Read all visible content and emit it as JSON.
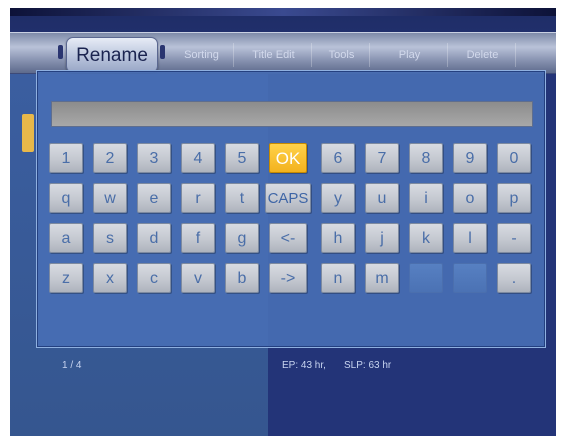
{
  "tabs": {
    "active": "Rename",
    "items": [
      "Sorting",
      "Title Edit",
      "Tools",
      "Play",
      "Delete"
    ]
  },
  "input": {
    "value": ""
  },
  "keyboard": {
    "rows": [
      [
        "1",
        "2",
        "3",
        "4",
        "5",
        "OK",
        "6",
        "7",
        "8",
        "9",
        "0"
      ],
      [
        "q",
        "w",
        "e",
        "r",
        "t",
        "CAPS",
        "y",
        "u",
        "i",
        "o",
        "p"
      ],
      [
        "a",
        "s",
        "d",
        "f",
        "g",
        "<-",
        "h",
        "j",
        "k",
        "l",
        "-"
      ],
      [
        "z",
        "x",
        "c",
        "v",
        "b",
        "->",
        "n",
        "m",
        "",
        "",
        "."
      ]
    ]
  },
  "status": {
    "page": "1 / 4",
    "ep": "EP: 43 hr,",
    "slp": "SLP: 63 hr"
  },
  "colors": {
    "ok_highlight": "#f3b21e",
    "screen_bg": "#2a3a80",
    "dialog_bg": "#486eb4"
  }
}
